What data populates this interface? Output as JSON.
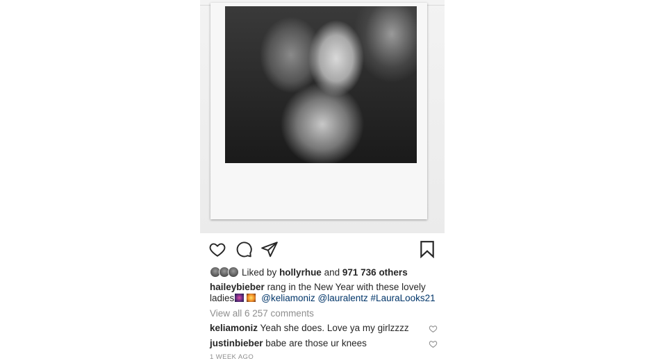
{
  "post": {
    "likes": {
      "prefix": "Liked by",
      "user": "hollyrhue",
      "conjunction": "and",
      "others": "971 736 others"
    },
    "caption": {
      "username": "haileybieber",
      "text": "rang in the New Year with these lovely ladies",
      "emojis": [
        "fireworks",
        "sparkler"
      ],
      "tags": [
        "@keliamoniz",
        "@lauralentz",
        "#LauraLooks21"
      ]
    },
    "view_all_comments": "View all 6 257 comments",
    "comments": [
      {
        "username": "keliamoniz",
        "text": "Yeah she does. Love ya my girlzzzz"
      },
      {
        "username": "justinbieber",
        "text": "babe are those ur knees"
      }
    ],
    "timestamp": "1 WEEK AGO"
  },
  "icons": {
    "like": "heart-icon",
    "comment": "comment-icon",
    "share": "paper-plane-icon",
    "save": "bookmark-icon",
    "comment_like": "heart-outline-icon"
  }
}
